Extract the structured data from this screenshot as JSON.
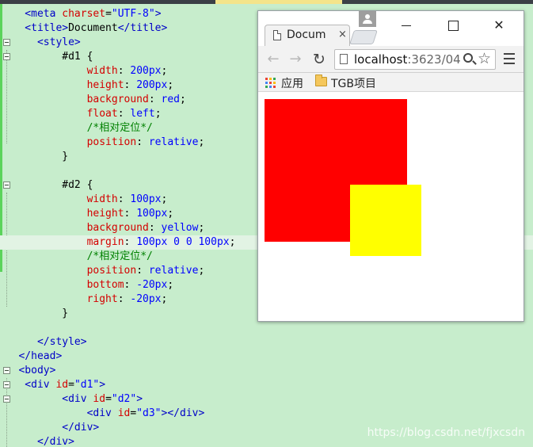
{
  "editor": {
    "lines": [
      {
        "fold": false,
        "cur": false,
        "tokens": [
          {
            "c": "tk-tag",
            "t": "    <meta "
          },
          {
            "c": "tk-attr",
            "t": "charset"
          },
          {
            "c": "tk-txt",
            "t": "="
          },
          {
            "c": "tk-str",
            "t": "\"UTF-8\""
          },
          {
            "c": "tk-tag",
            "t": ">"
          }
        ]
      },
      {
        "fold": false,
        "cur": false,
        "tokens": [
          {
            "c": "tk-tag",
            "t": "    <title>"
          },
          {
            "c": "tk-txt",
            "t": "Document"
          },
          {
            "c": "tk-tag",
            "t": "</title>"
          }
        ]
      },
      {
        "fold": true,
        "cur": false,
        "tokens": [
          {
            "c": "tk-tag",
            "t": "      <style>"
          }
        ]
      },
      {
        "fold": true,
        "cur": false,
        "tokens": [
          {
            "c": "tk-sel",
            "t": "          #d1 {"
          }
        ]
      },
      {
        "fold": false,
        "cur": false,
        "tokens": [
          {
            "c": "tk-prop",
            "t": "              width"
          },
          {
            "c": "tk-txt",
            "t": ": "
          },
          {
            "c": "tk-val",
            "t": "200px"
          },
          {
            "c": "tk-txt",
            "t": ";"
          }
        ]
      },
      {
        "fold": false,
        "cur": false,
        "tokens": [
          {
            "c": "tk-prop",
            "t": "              height"
          },
          {
            "c": "tk-txt",
            "t": ": "
          },
          {
            "c": "tk-val",
            "t": "200px"
          },
          {
            "c": "tk-txt",
            "t": ";"
          }
        ]
      },
      {
        "fold": false,
        "cur": false,
        "tokens": [
          {
            "c": "tk-prop",
            "t": "              background"
          },
          {
            "c": "tk-txt",
            "t": ": "
          },
          {
            "c": "tk-val",
            "t": "red"
          },
          {
            "c": "tk-txt",
            "t": ";"
          }
        ]
      },
      {
        "fold": false,
        "cur": false,
        "tokens": [
          {
            "c": "tk-prop",
            "t": "              float"
          },
          {
            "c": "tk-txt",
            "t": ": "
          },
          {
            "c": "tk-val",
            "t": "left"
          },
          {
            "c": "tk-txt",
            "t": ";"
          }
        ]
      },
      {
        "fold": false,
        "cur": false,
        "tokens": [
          {
            "c": "tk-com",
            "t": "              /*相对定位*/"
          }
        ]
      },
      {
        "fold": false,
        "cur": false,
        "tokens": [
          {
            "c": "tk-prop",
            "t": "              position"
          },
          {
            "c": "tk-txt",
            "t": ": "
          },
          {
            "c": "tk-val",
            "t": "relative"
          },
          {
            "c": "tk-txt",
            "t": ";"
          }
        ]
      },
      {
        "fold": false,
        "cur": false,
        "tokens": [
          {
            "c": "tk-txt",
            "t": "          }"
          }
        ]
      },
      {
        "fold": false,
        "cur": false,
        "tokens": [
          {
            "c": "tk-txt",
            "t": ""
          }
        ]
      },
      {
        "fold": true,
        "cur": false,
        "tokens": [
          {
            "c": "tk-sel",
            "t": "          #d2 {"
          }
        ]
      },
      {
        "fold": false,
        "cur": false,
        "tokens": [
          {
            "c": "tk-prop",
            "t": "              width"
          },
          {
            "c": "tk-txt",
            "t": ": "
          },
          {
            "c": "tk-val",
            "t": "100px"
          },
          {
            "c": "tk-txt",
            "t": ";"
          }
        ]
      },
      {
        "fold": false,
        "cur": false,
        "tokens": [
          {
            "c": "tk-prop",
            "t": "              height"
          },
          {
            "c": "tk-txt",
            "t": ": "
          },
          {
            "c": "tk-val",
            "t": "100px"
          },
          {
            "c": "tk-txt",
            "t": ";"
          }
        ]
      },
      {
        "fold": false,
        "cur": false,
        "tokens": [
          {
            "c": "tk-prop",
            "t": "              background"
          },
          {
            "c": "tk-txt",
            "t": ": "
          },
          {
            "c": "tk-val",
            "t": "yellow"
          },
          {
            "c": "tk-txt",
            "t": ";"
          }
        ]
      },
      {
        "fold": false,
        "cur": true,
        "tokens": [
          {
            "c": "tk-prop",
            "t": "              margin"
          },
          {
            "c": "tk-txt",
            "t": ": "
          },
          {
            "c": "tk-val",
            "t": "100px 0 0 100px"
          },
          {
            "c": "tk-txt",
            "t": ";"
          }
        ]
      },
      {
        "fold": false,
        "cur": false,
        "tokens": [
          {
            "c": "tk-com",
            "t": "              /*相对定位*/"
          }
        ]
      },
      {
        "fold": false,
        "cur": false,
        "tokens": [
          {
            "c": "tk-prop",
            "t": "              position"
          },
          {
            "c": "tk-txt",
            "t": ": "
          },
          {
            "c": "tk-val",
            "t": "relative"
          },
          {
            "c": "tk-txt",
            "t": ";"
          }
        ]
      },
      {
        "fold": false,
        "cur": false,
        "tokens": [
          {
            "c": "tk-prop",
            "t": "              bottom"
          },
          {
            "c": "tk-txt",
            "t": ": "
          },
          {
            "c": "tk-val",
            "t": "-20px"
          },
          {
            "c": "tk-txt",
            "t": ";"
          }
        ]
      },
      {
        "fold": false,
        "cur": false,
        "tokens": [
          {
            "c": "tk-prop",
            "t": "              right"
          },
          {
            "c": "tk-txt",
            "t": ": "
          },
          {
            "c": "tk-val",
            "t": "-20px"
          },
          {
            "c": "tk-txt",
            "t": ";"
          }
        ]
      },
      {
        "fold": false,
        "cur": false,
        "tokens": [
          {
            "c": "tk-txt",
            "t": "          }"
          }
        ]
      },
      {
        "fold": false,
        "cur": false,
        "tokens": [
          {
            "c": "tk-txt",
            "t": ""
          }
        ]
      },
      {
        "fold": false,
        "cur": false,
        "tokens": [
          {
            "c": "tk-tag",
            "t": "      </style>"
          }
        ]
      },
      {
        "fold": false,
        "cur": false,
        "tokens": [
          {
            "c": "tk-tag",
            "t": "   </head>"
          }
        ]
      },
      {
        "fold": true,
        "cur": false,
        "tokens": [
          {
            "c": "tk-tag",
            "t": "   <body>"
          }
        ]
      },
      {
        "fold": true,
        "cur": false,
        "tokens": [
          {
            "c": "tk-tag",
            "t": "    <div "
          },
          {
            "c": "tk-attr",
            "t": "id"
          },
          {
            "c": "tk-txt",
            "t": "="
          },
          {
            "c": "tk-str",
            "t": "\"d1\""
          },
          {
            "c": "tk-tag",
            "t": ">"
          }
        ]
      },
      {
        "fold": true,
        "cur": false,
        "tokens": [
          {
            "c": "tk-tag",
            "t": "          <div "
          },
          {
            "c": "tk-attr",
            "t": "id"
          },
          {
            "c": "tk-txt",
            "t": "="
          },
          {
            "c": "tk-str",
            "t": "\"d2\""
          },
          {
            "c": "tk-tag",
            "t": ">"
          }
        ]
      },
      {
        "fold": false,
        "cur": false,
        "tokens": [
          {
            "c": "tk-tag",
            "t": "              <div "
          },
          {
            "c": "tk-attr",
            "t": "id"
          },
          {
            "c": "tk-txt",
            "t": "="
          },
          {
            "c": "tk-str",
            "t": "\"d3\""
          },
          {
            "c": "tk-tag",
            "t": "></div>"
          }
        ]
      },
      {
        "fold": false,
        "cur": false,
        "tokens": [
          {
            "c": "tk-tag",
            "t": "          </div>"
          }
        ]
      },
      {
        "fold": false,
        "cur": false,
        "tokens": [
          {
            "c": "tk-tag",
            "t": "      </div>"
          }
        ]
      }
    ]
  },
  "browser": {
    "tab_title": "Document",
    "tab_close": "×",
    "url_host": "localhost",
    "url_rest": ":3623/04",
    "nav_back": "←",
    "nav_forward": "→",
    "nav_reload": "↻",
    "star": "☆",
    "bookmarks": {
      "apps_label": "应用",
      "folder_label": "TGB项目"
    },
    "apps_icon_colors": [
      "#ea4335",
      "#fbbc05",
      "#34a853",
      "#4285f4",
      "#ea4335",
      "#fbbc05",
      "#34a853",
      "#4285f4",
      "#ea4335"
    ],
    "boxes": {
      "d1_color": "#ff0000",
      "d2_color": "#ffff00"
    }
  },
  "watermark": "https://blog.csdn.net/fjxcsdn"
}
